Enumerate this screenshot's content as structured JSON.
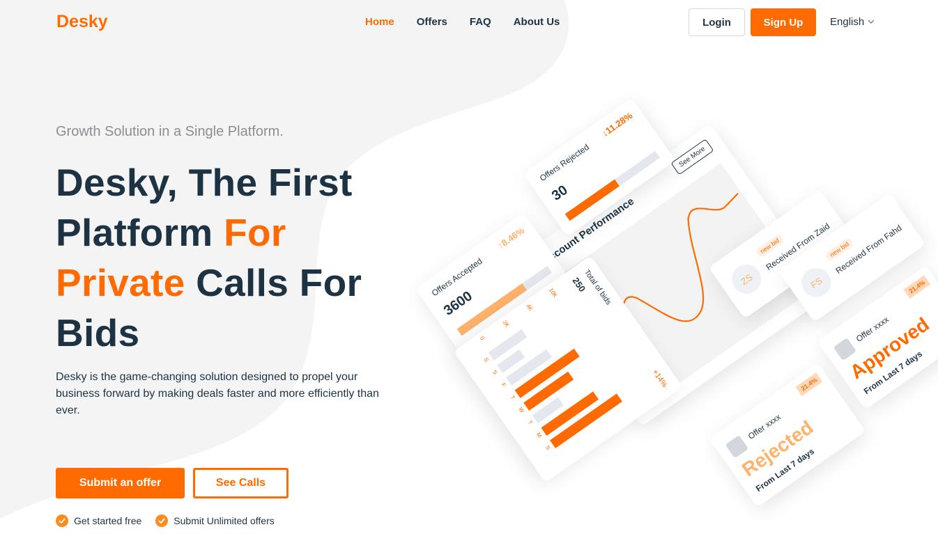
{
  "brand": {
    "logo": "Desky",
    "accent": "#ff6b00",
    "dark": "#1d3343"
  },
  "nav": {
    "items": [
      {
        "label": "Home",
        "active": true
      },
      {
        "label": "Offers",
        "active": false
      },
      {
        "label": "FAQ",
        "active": false
      },
      {
        "label": "About Us",
        "active": false
      }
    ],
    "login": "Login",
    "signup": "Sign Up",
    "language": "English"
  },
  "hero": {
    "subhead": "Growth Solution in a Single Platform.",
    "headline_1": "Desky, The First Platform ",
    "headline_accent_1": "For",
    "headline_accent_2": "Private",
    "headline_2": " Calls For Bids",
    "description": "Desky is the game-changing solution designed to propel your business forward by making deals faster and more efficiently than ever.",
    "primary_cta": "Submit an offer",
    "secondary_cta": "See Calls",
    "features": [
      "Get started free",
      "Submit Unlimited offers"
    ]
  },
  "dashboard": {
    "rejected_card": {
      "label": "Offers Rejected",
      "value": "30",
      "change": "↓11.28%"
    },
    "accepted_card": {
      "label": "Offers Accepted",
      "value": "3600",
      "change": "↑8.46%"
    },
    "performance": {
      "title": "Account Performance",
      "see_more": "See More"
    },
    "bids": [
      {
        "initials": "ZS",
        "tag": "new bid",
        "text": "Received From Zaid"
      },
      {
        "initials": "FS",
        "tag": "new bid",
        "text": "Received From Fahd"
      }
    ],
    "total_bids": {
      "label": "Total of bids",
      "value": "250",
      "change": "+14%",
      "days": [
        "S",
        "S",
        "F",
        "T",
        "W",
        "T",
        "M",
        "S"
      ],
      "ticks": [
        "10K",
        "4K",
        "2K",
        "0"
      ]
    },
    "approved": {
      "offer": "Offer xxxx",
      "status": "Approved",
      "period": "From Last 7 days",
      "badge": "21.4%"
    },
    "rejected": {
      "offer": "Offer xxxx",
      "status": "Rejected",
      "period": "From Last 7 days",
      "badge": "21.4%"
    }
  }
}
